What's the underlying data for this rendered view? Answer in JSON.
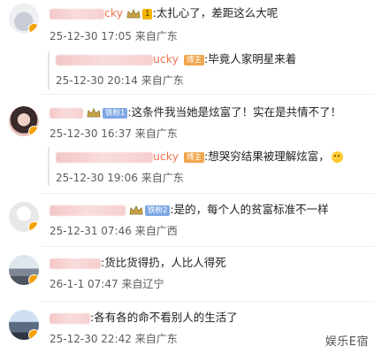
{
  "comments": [
    {
      "user_suffix": "cky",
      "tag": "1",
      "text": ":太扎心了，差距这么大呢",
      "time": "25-12-30 17:05",
      "source": "来自广东"
    },
    {
      "user_suffix": "ucky",
      "tag": "博主",
      "text": ":毕竟人家明星来着",
      "time": "25-12-30 20:14",
      "source": "来自广东",
      "reply": true
    },
    {
      "tag": "铁粉1",
      "text": ":这条件我当她是炫富了！实在是共情不了！",
      "time": "25-12-30 16:37",
      "source": "来自广东"
    },
    {
      "user_suffix": "ucky",
      "tag": "博主",
      "text": ":想哭穷结果被理解炫富，",
      "time": "25-12-30 19:06",
      "source": "来自广东",
      "reply": true
    },
    {
      "tag": "铁粉2",
      "text": ":是的，每个人的贫富标准不一样",
      "time": "25-12-31 07:46",
      "source": "来自广西"
    },
    {
      "text": ":货比货得扔，人比人得死",
      "time": "26-1-1 07:47",
      "source": "来自辽宁"
    },
    {
      "text": ":各有各的命不看别人的生活了",
      "time": "25-12-30 22:42",
      "source": "来自广东"
    }
  ],
  "watermark": "娱乐E宿",
  "icons": {
    "crown": "crown-icon",
    "avatar_badge": "verified-badge-icon",
    "emoji": "emoji-icon"
  },
  "colors": {
    "username": "#eb7350",
    "meta": "#5c5c5c",
    "tag_blog": "#f0a64d",
    "tag_fan": "#7ea7e3"
  }
}
